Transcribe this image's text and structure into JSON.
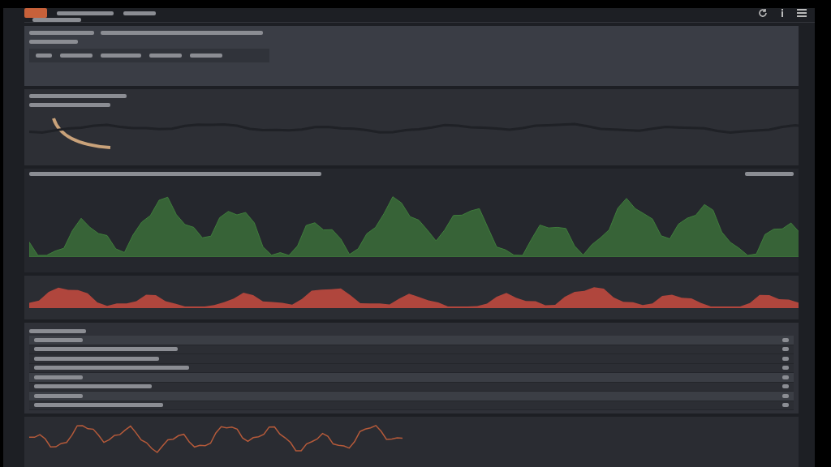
{
  "toolbar_icons": [
    {
      "kind": "refresh"
    },
    {
      "kind": "info"
    },
    {
      "kind": "menu"
    }
  ],
  "panels": [
    {
      "kind": "filter",
      "color": "#3a3d45"
    },
    {
      "kind": "overview",
      "color": "#c9a27a"
    },
    {
      "kind": "wave",
      "color": "#3f7d3c"
    },
    {
      "kind": "area",
      "color": "#b0463d"
    },
    {
      "kind": "log",
      "color": "#2f3138"
    },
    {
      "kind": "spikes",
      "color": "#b55a3a"
    }
  ],
  "log_rows": [
    {
      "kind": "group"
    },
    {
      "kind": "entry"
    },
    {
      "kind": "entry"
    },
    {
      "kind": "entry"
    },
    {
      "kind": "group"
    },
    {
      "kind": "entry"
    },
    {
      "kind": "group"
    },
    {
      "kind": "entry"
    }
  ]
}
